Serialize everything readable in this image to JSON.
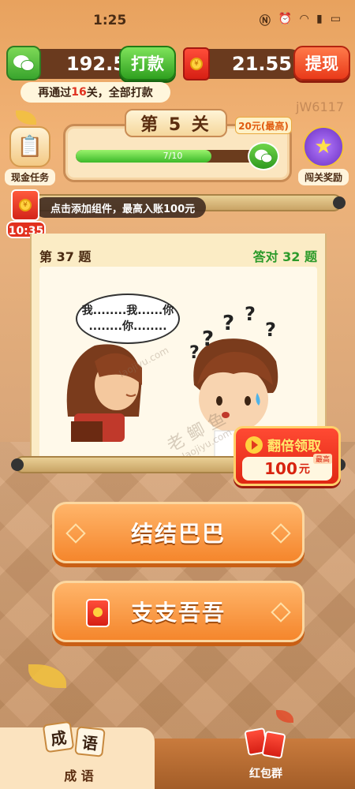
{
  "status_bar": {
    "time": "1:25",
    "icons": [
      "nfc-icon",
      "alarm-icon",
      "wifi-icon",
      "signal-icon",
      "battery-icon"
    ]
  },
  "top_bar": {
    "cash_amount": "192.5",
    "cash_button": "打款",
    "redpack_amount": "21.55",
    "withdraw_button": "提现"
  },
  "tip": {
    "prefix": "再通过",
    "count": "16",
    "suffix": "关，全部打款"
  },
  "level": {
    "title": "第 5 关",
    "max_tag": "20元(最高)",
    "progress_text": "7/10",
    "progress_fraction": 0.7
  },
  "side_buttons": {
    "left_label": "现金任务",
    "right_label": "闯关奖励"
  },
  "widget_bar": {
    "message": "点击添加组件，最高入账100元",
    "timer": "10:35"
  },
  "question": {
    "number_text": "第 37 题",
    "correct_text": "答对 32 题",
    "bubble_line1": "我........我......你",
    "bubble_line2": "........你........"
  },
  "watermarks": {
    "corner": "jW6117",
    "site1": "laojiyu.com",
    "site2": "laojiyu.com",
    "brand": "老 鲫 鱼"
  },
  "double_reward": {
    "title": "翻倍领取",
    "amount": "100",
    "unit": "元",
    "max_tag": "最高"
  },
  "answers": [
    {
      "text": "结结巴巴"
    },
    {
      "text": "支支吾吾"
    }
  ],
  "bottom_nav": {
    "tab1_tile1": "成",
    "tab1_tile2": "语",
    "tab1_label": "成 语",
    "tab2_label": "红包群"
  },
  "colors": {
    "accent_green": "#3cb92a",
    "accent_red": "#e02713",
    "answer_orange": "#f5862c"
  }
}
